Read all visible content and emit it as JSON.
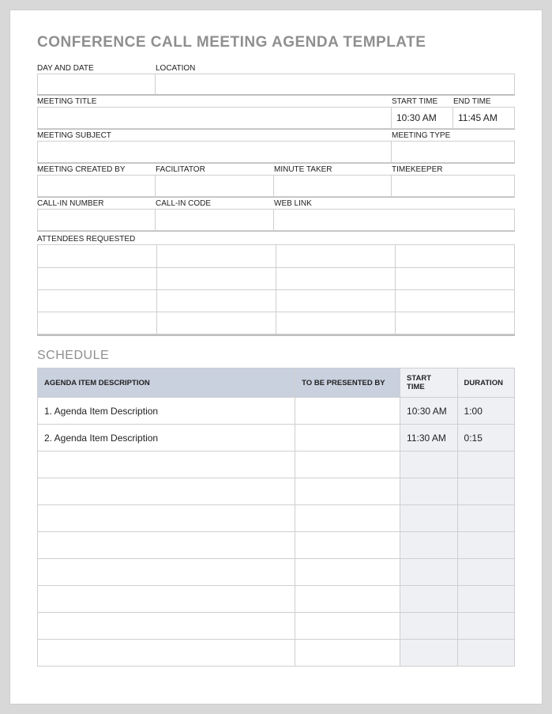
{
  "title": "CONFERENCE CALL MEETING AGENDA TEMPLATE",
  "labels": {
    "day_date": "DAY AND DATE",
    "location": "LOCATION",
    "meeting_title": "MEETING TITLE",
    "start_time": "START TIME",
    "end_time": "END TIME",
    "meeting_subject": "MEETING SUBJECT",
    "meeting_type": "MEETING TYPE",
    "created_by": "MEETING CREATED BY",
    "facilitator": "FACILITATOR",
    "minute_taker": "MINUTE TAKER",
    "timekeeper": "TIMEKEEPER",
    "callin_number": "CALL-IN NUMBER",
    "callin_code": "CALL-IN CODE",
    "web_link": "WEB LINK",
    "attendees": "ATTENDEES REQUESTED"
  },
  "values": {
    "day_date": "",
    "location": "",
    "meeting_title": "",
    "start_time": "10:30 AM",
    "end_time": "11:45 AM",
    "meeting_subject": "",
    "meeting_type": "",
    "created_by": "",
    "facilitator": "",
    "minute_taker": "",
    "timekeeper": "",
    "callin_number": "",
    "callin_code": "",
    "web_link": ""
  },
  "schedule_section_title": "SCHEDULE",
  "schedule_headers": {
    "description": "AGENDA ITEM DESCRIPTION",
    "presenter": "TO BE PRESENTED BY",
    "start": "START TIME",
    "duration": "DURATION"
  },
  "schedule_rows": [
    {
      "description": "1. Agenda Item Description",
      "presenter": "",
      "start": "10:30 AM",
      "duration": "1:00"
    },
    {
      "description": "2. Agenda Item Description",
      "presenter": "",
      "start": "11:30 AM",
      "duration": "0:15"
    },
    {
      "description": "",
      "presenter": "",
      "start": "",
      "duration": ""
    },
    {
      "description": "",
      "presenter": "",
      "start": "",
      "duration": ""
    },
    {
      "description": "",
      "presenter": "",
      "start": "",
      "duration": ""
    },
    {
      "description": "",
      "presenter": "",
      "start": "",
      "duration": ""
    },
    {
      "description": "",
      "presenter": "",
      "start": "",
      "duration": ""
    },
    {
      "description": "",
      "presenter": "",
      "start": "",
      "duration": ""
    },
    {
      "description": "",
      "presenter": "",
      "start": "",
      "duration": ""
    },
    {
      "description": "",
      "presenter": "",
      "start": "",
      "duration": ""
    }
  ]
}
